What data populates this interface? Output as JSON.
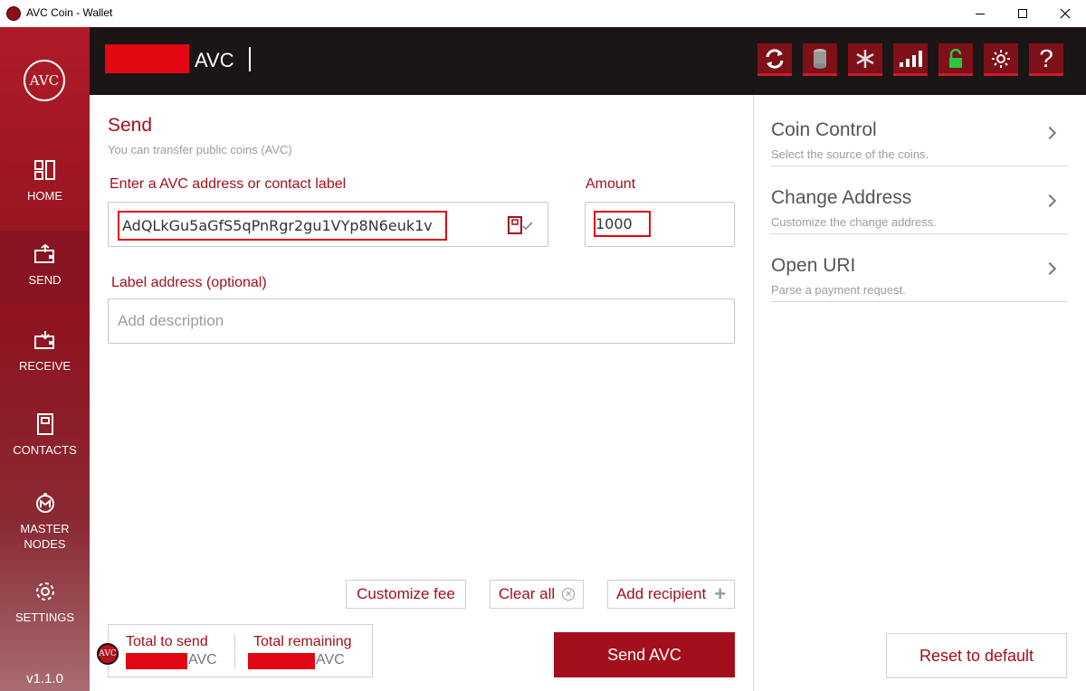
{
  "window": {
    "title": "AVC Coin - Wallet"
  },
  "sidebar": {
    "logo_text": "AVC",
    "items": [
      {
        "label": "HOME",
        "icon": "home-grid-icon"
      },
      {
        "label": "SEND",
        "icon": "send-wallet-icon",
        "active": true
      },
      {
        "label": "RECEIVE",
        "icon": "receive-wallet-icon"
      },
      {
        "label": "CONTACTS",
        "icon": "contacts-book-icon"
      },
      {
        "label": "MASTER NODES",
        "icon": "masternodes-icon"
      },
      {
        "label": "SETTINGS",
        "icon": "gear-icon"
      }
    ],
    "version": "v1.1.0"
  },
  "header": {
    "balance_unit": "AVC",
    "buttons": [
      "sync-icon",
      "database-icon",
      "snowflake-icon",
      "signal-bars-icon",
      "lock-icon",
      "sun-icon",
      "help-icon"
    ]
  },
  "send": {
    "title": "Send",
    "subtitle": "You can transfer public coins (AVC)",
    "address_label": "Enter a AVC address or contact label",
    "address_value": "AdQLkGu5aGfS5qPnRgr2gu1VYp8N6euk1v",
    "amount_label": "Amount",
    "amount_value": "1000",
    "label_address_label": "Label address (optional)",
    "description_placeholder": "Add description",
    "customize_fee": "Customize fee",
    "clear_all": "Clear all",
    "add_recipient": "Add recipient",
    "total_to_send_label": "Total to send",
    "total_remaining_label": "Total remaining",
    "total_unit": "AVC",
    "send_button": "Send AVC"
  },
  "options": [
    {
      "title": "Coin Control",
      "subtitle": "Select the source of the coins."
    },
    {
      "title": "Change Address",
      "subtitle": "Customize the change address."
    },
    {
      "title": "Open URI",
      "subtitle": "Parse a payment request."
    }
  ],
  "reset_button": "Reset to default",
  "colors": {
    "accent": "#a30f1c",
    "redaction": "#e30613",
    "header_bg": "#1b1516"
  }
}
